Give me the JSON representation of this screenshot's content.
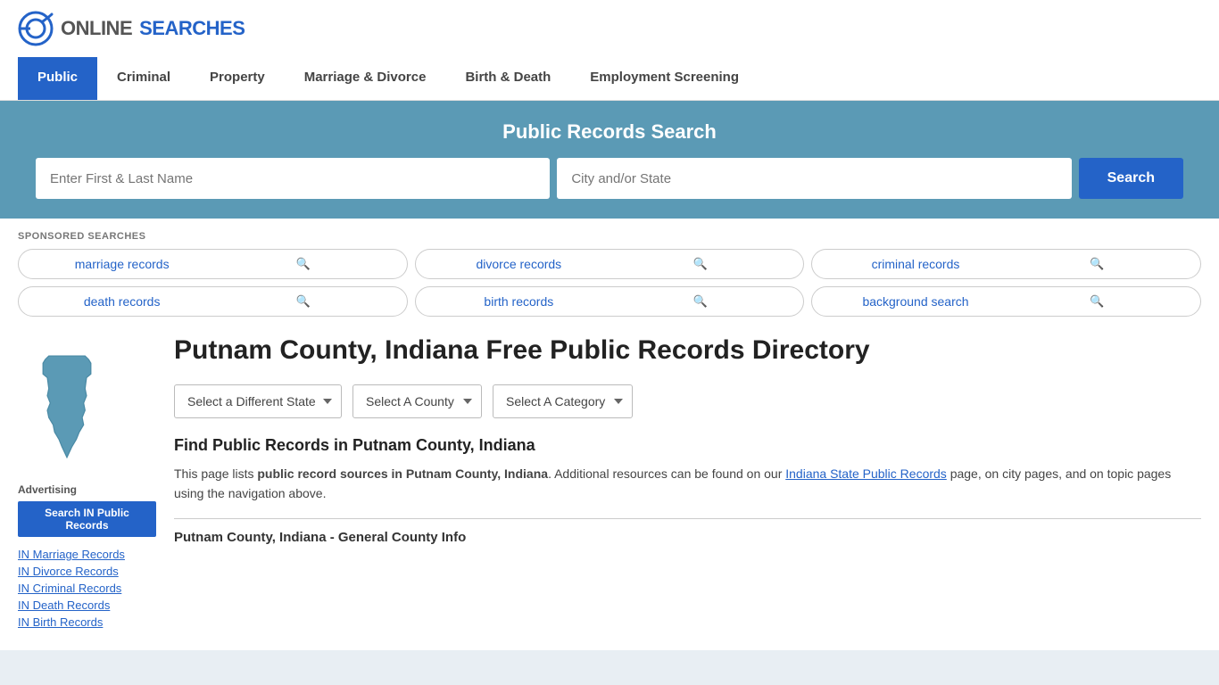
{
  "logo": {
    "text_online": "ONLINE",
    "text_searches": "SEARCHES"
  },
  "nav": {
    "items": [
      {
        "label": "Public",
        "active": true
      },
      {
        "label": "Criminal",
        "active": false
      },
      {
        "label": "Property",
        "active": false
      },
      {
        "label": "Marriage & Divorce",
        "active": false
      },
      {
        "label": "Birth & Death",
        "active": false
      },
      {
        "label": "Employment Screening",
        "active": false
      }
    ]
  },
  "search_banner": {
    "title": "Public Records Search",
    "name_placeholder": "Enter First & Last Name",
    "location_placeholder": "City and/or State",
    "button_label": "Search"
  },
  "sponsored": {
    "label": "SPONSORED SEARCHES",
    "tags": [
      {
        "label": "marriage records"
      },
      {
        "label": "divorce records"
      },
      {
        "label": "criminal records"
      },
      {
        "label": "death records"
      },
      {
        "label": "birth records"
      },
      {
        "label": "background search"
      }
    ]
  },
  "page": {
    "title": "Putnam County, Indiana Free Public Records Directory",
    "dropdowns": {
      "state": "Select a Different State",
      "county": "Select A County",
      "category": "Select A Category"
    },
    "find_title": "Find Public Records in Putnam County, Indiana",
    "find_desc_before": "This page lists ",
    "find_desc_bold": "public record sources in Putnam County, Indiana",
    "find_desc_middle": ". Additional resources can be found on our ",
    "find_desc_link": "Indiana State Public Records",
    "find_desc_after": " page, on city pages, and on topic pages using the navigation above.",
    "section_subtitle": "Putnam County, Indiana - General County Info"
  },
  "sidebar": {
    "ad_label": "Advertising",
    "ad_button": "Search IN Public Records",
    "links": [
      {
        "label": "IN Marriage Records"
      },
      {
        "label": "IN Divorce Records"
      },
      {
        "label": "IN Criminal Records"
      },
      {
        "label": "IN Death Records"
      },
      {
        "label": "IN Birth Records"
      }
    ]
  }
}
